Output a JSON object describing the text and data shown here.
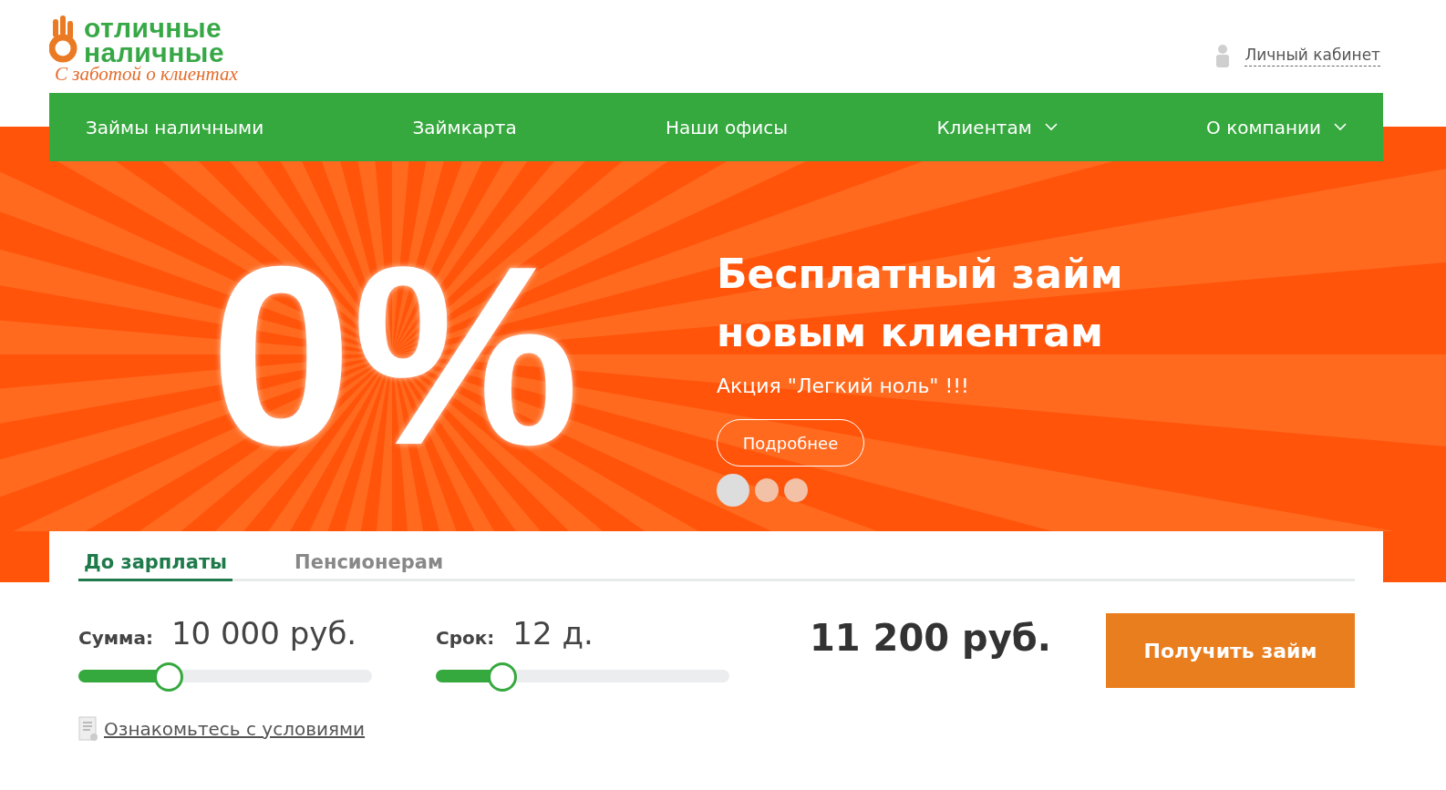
{
  "logo": {
    "line1": "отличные",
    "line2": "наличные",
    "tagline": "С заботой о клиентах"
  },
  "account_link": "Личный кабинет",
  "nav": [
    {
      "label": "Займы наличными",
      "dropdown": false
    },
    {
      "label": "Займкарта",
      "dropdown": false
    },
    {
      "label": "Наши офисы",
      "dropdown": false
    },
    {
      "label": "Клиентам",
      "dropdown": true
    },
    {
      "label": "О компании",
      "dropdown": true
    }
  ],
  "banner": {
    "big_text": "0%",
    "title_line1": "Бесплатный займ",
    "title_line2": "новым клиентам",
    "subtitle": "Акция \"Легкий ноль\" !!!",
    "button": "Подробнее",
    "dots": [
      {
        "selected": true
      },
      {
        "selected": false
      },
      {
        "selected": false
      }
    ]
  },
  "tabs": [
    {
      "label": "До зарплаты",
      "selected": true
    },
    {
      "label": "Пенсионерам",
      "selected": false
    }
  ],
  "calculator": {
    "sliders": [
      {
        "label": "Сумма:",
        "value": "10 000 руб.",
        "level": 0.3
      },
      {
        "label": "Срок:",
        "value": "12 д.",
        "level": 0.22
      }
    ],
    "total": "11 200 руб.",
    "button": "Получить займ",
    "terms_link": "Ознакомьтесь с условиями"
  }
}
